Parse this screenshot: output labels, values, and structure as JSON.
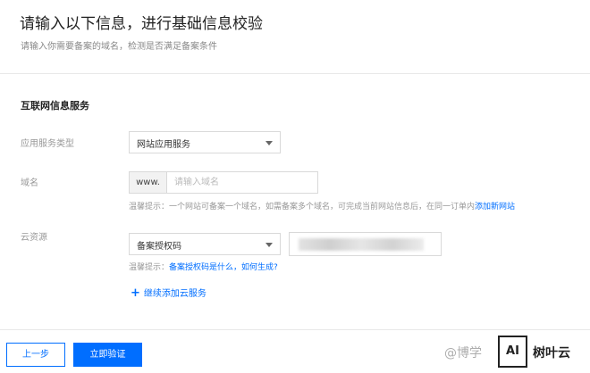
{
  "header": {
    "title": "请输入以下信息，进行基础信息校验",
    "subtitle": "请输入你需要备案的域名，检测是否满足备案条件"
  },
  "section": {
    "title": "互联网信息服务"
  },
  "form": {
    "service_type": {
      "label": "应用服务类型",
      "value": "网站应用服务"
    },
    "domain": {
      "label": "域名",
      "prefix": "www.",
      "placeholder": "请输入域名",
      "hint": "温馨提示：一个网站可备案一个域名，如需备案多个域名，可完成当前网站信息后，在同一订单内",
      "hint_link": "添加新网站"
    },
    "cloud_resource": {
      "label": "云资源",
      "value": "备案授权码",
      "hint": "温馨提示：",
      "hint_link": "备案授权码是什么，如何生成?"
    },
    "add_service_label": "继续添加云服务"
  },
  "footer": {
    "prev_label": "上一步",
    "verify_label": "立即验证"
  },
  "watermark": {
    "text": "@博学",
    "logo_text": "AI",
    "brand": "树叶云"
  },
  "colors": {
    "accent": "#006eff"
  }
}
